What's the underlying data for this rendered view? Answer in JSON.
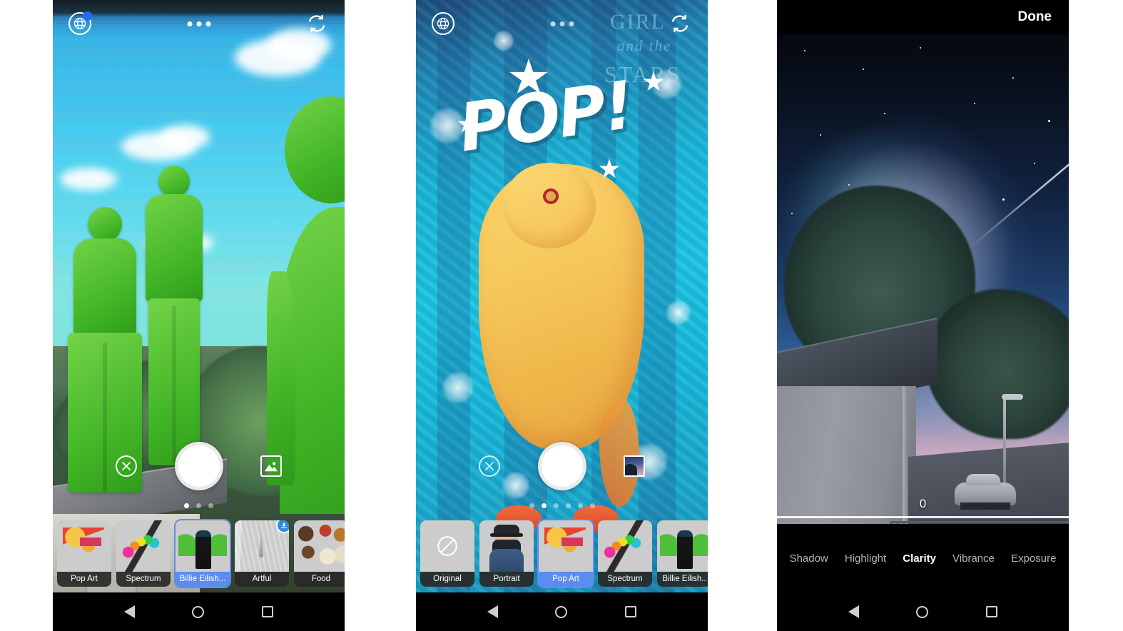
{
  "panel1": {
    "topbar": {
      "globe_icon": "globe-icon",
      "globe_badge": "notification-badge",
      "more_icon": "more-options-icon",
      "flip_icon": "flip-camera-icon"
    },
    "controls": {
      "close_icon": "close-icon",
      "shutter": "shutter-button",
      "gallery_icon": "gallery-icon"
    },
    "page_dots": {
      "count": 3,
      "active": 0
    },
    "filters": [
      {
        "label": "Pop Art",
        "art": "th-popart",
        "selected": false,
        "download": false
      },
      {
        "label": "Spectrum",
        "art": "th-spectrum",
        "selected": false,
        "download": false
      },
      {
        "label": "Billie Eilish...",
        "art": "th-billie",
        "selected": true,
        "download": false
      },
      {
        "label": "Artful",
        "art": "th-artful",
        "selected": false,
        "download": true
      },
      {
        "label": "Food",
        "art": "th-food",
        "selected": false,
        "download": false
      }
    ]
  },
  "panel2": {
    "topbar": {
      "globe_icon": "globe-icon",
      "more_icon": "more-options-icon",
      "flip_icon": "flip-camera-icon"
    },
    "artwork": {
      "headline": "POP!",
      "background_text_1": "GIRL",
      "background_text_2": "and the",
      "background_text_3": "STARS"
    },
    "controls": {
      "close_icon": "close-icon",
      "shutter": "shutter-button",
      "gallery_icon": "gallery-thumbnail"
    },
    "page_dots": {
      "count": 6,
      "active": 1
    },
    "filters": [
      {
        "label": "Original",
        "art": "th-original",
        "selected": false
      },
      {
        "label": "Portrait",
        "art": "th-portrait",
        "selected": false
      },
      {
        "label": "Pop Art",
        "art": "th-popart",
        "selected": true
      },
      {
        "label": "Spectrum",
        "art": "th-spectrum",
        "selected": false
      },
      {
        "label": "Billie Eilish..",
        "art": "th-billie",
        "selected": false
      }
    ]
  },
  "panel3": {
    "done_label": "Done",
    "slider_value": "0",
    "adjustments": [
      {
        "label": "Shadow",
        "active": false
      },
      {
        "label": "Highlight",
        "active": false
      },
      {
        "label": "Clarity",
        "active": true
      },
      {
        "label": "Vibrance",
        "active": false
      },
      {
        "label": "Exposure",
        "active": false
      }
    ]
  },
  "navbar": {
    "back_icon": "back-icon",
    "home_icon": "home-icon",
    "recents_icon": "recents-icon"
  }
}
